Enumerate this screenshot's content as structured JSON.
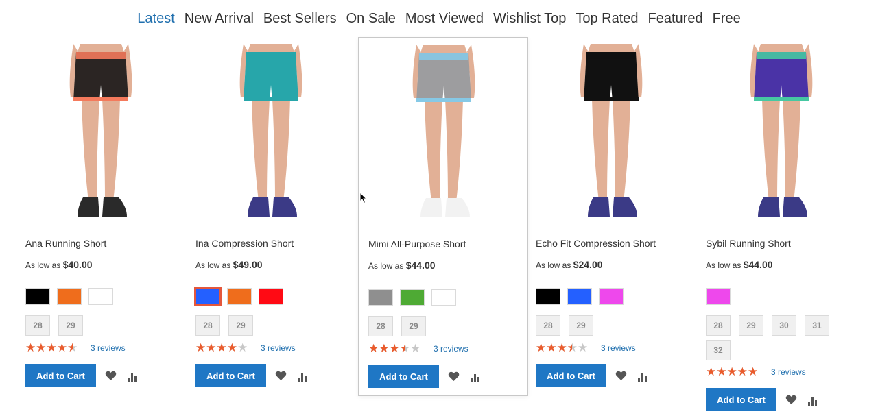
{
  "tabs": [
    {
      "label": "Latest",
      "active": true
    },
    {
      "label": "New Arrival",
      "active": false
    },
    {
      "label": "Best Sellers",
      "active": false
    },
    {
      "label": "On Sale",
      "active": false
    },
    {
      "label": "Most Viewed",
      "active": false
    },
    {
      "label": "Wishlist Top",
      "active": false
    },
    {
      "label": "Top Rated",
      "active": false
    },
    {
      "label": "Featured",
      "active": false
    },
    {
      "label": "Free",
      "active": false
    }
  ],
  "colors": {
    "accent": "#1f6fae",
    "button": "#1f77c5",
    "star": "#ea5b2c"
  },
  "common": {
    "price_prefix": "As low as",
    "add_to_cart": "Add to Cart",
    "wishlist_icon": "heart-icon",
    "compare_icon": "bar-chart-icon"
  },
  "products": [
    {
      "name": "Ana Running Short",
      "price": "$40.00",
      "colors": [
        "#000000",
        "#ef6d1c",
        "#ffffff"
      ],
      "selected_color": -1,
      "sizes": [
        "28",
        "29"
      ],
      "rating": 0.8,
      "reviews": "3 reviews",
      "image": {
        "top": "#2b2523",
        "trim": "#f47a5c",
        "skin": "#e2b096",
        "shoe": "#2a2a2a"
      }
    },
    {
      "name": "Ina Compression Short",
      "price": "$49.00",
      "colors": [
        "#2460ff",
        "#ef6d1c",
        "#ff0a14"
      ],
      "selected_color": 0,
      "sizes": [
        "28",
        "29"
      ],
      "rating": 0.7,
      "reviews": "3 reviews",
      "image": {
        "top": "#27a6aa",
        "trim": "#27a6aa",
        "skin": "#e2b096",
        "shoe": "#3b3a86"
      }
    },
    {
      "name": "Mimi All-Purpose Short",
      "price": "$44.00",
      "colors": [
        "#8f8f8f",
        "#4eaa34",
        "#ffffff"
      ],
      "selected_color": -1,
      "sizes": [
        "28",
        "29"
      ],
      "rating": 0.6,
      "reviews": "3 reviews",
      "image": {
        "top": "#9d9d9f",
        "trim": "#86c9e6",
        "skin": "#e2b096",
        "shoe": "#f2f2f2"
      }
    },
    {
      "name": "Echo Fit Compression Short",
      "price": "$24.00",
      "colors": [
        "#000000",
        "#2460ff",
        "#ee48ec"
      ],
      "selected_color": -1,
      "sizes": [
        "28",
        "29"
      ],
      "rating": 0.6,
      "reviews": "3 reviews",
      "image": {
        "top": "#111111",
        "trim": "#111111",
        "skin": "#e2b096",
        "shoe": "#3b3a86"
      }
    },
    {
      "name": "Sybil Running Short",
      "price": "$44.00",
      "colors": [
        "#ee48ec"
      ],
      "selected_color": -1,
      "sizes": [
        "28",
        "29",
        "30",
        "31",
        "32"
      ],
      "rating": 0.9,
      "reviews": "3 reviews",
      "image": {
        "top": "#4a33a6",
        "trim": "#46c8a2",
        "skin": "#e2b096",
        "shoe": "#3b3a86"
      }
    }
  ]
}
